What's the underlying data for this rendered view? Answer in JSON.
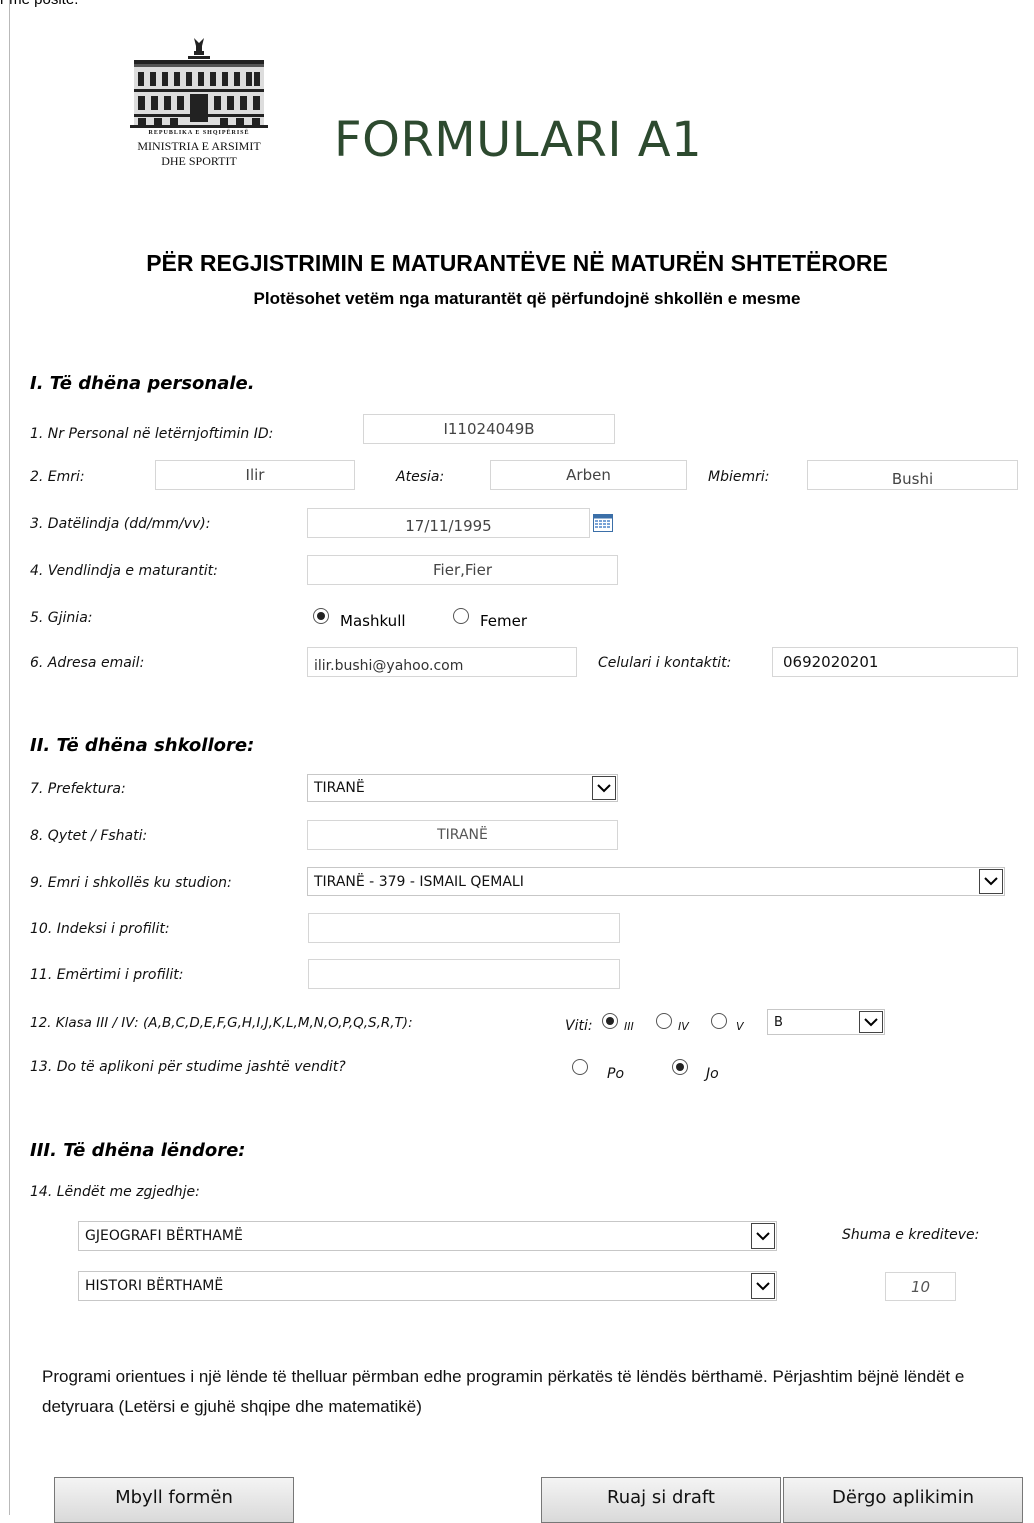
{
  "top_clip_text": "r me posite.",
  "logo": {
    "line1": "REPUBLIKA E SHQIPËRISË",
    "line2": "MINISTRIA E ARSIMIT",
    "line3": "DHE SPORTIT"
  },
  "title": "FORMULARI A1",
  "heading": "PËR REGJISTRIMIN E MATURANTËVE NË MATURËN SHTETËRORE",
  "subheading": "Plotësohet vetëm nga maturantët që përfundojnë shkollën e mesme",
  "section1": "I. Të dhëna personale.",
  "section2": "II. Të dhëna shkollore:",
  "section3": "III. Të dhëna lëndore:",
  "labels": {
    "nr_personal": "1. Nr Personal në letërnjoftimin ID:",
    "emri": "2. Emri:",
    "atesia": "Atesia:",
    "mbiemri": "Mbiemri:",
    "datelindja": "3. Datëlindja (dd/mm/vv):",
    "vendlindja": "4. Vendlindja e maturantit:",
    "gjinia": "5. Gjinia:",
    "email": "6. Adresa email:",
    "celulari": "Celulari i kontaktit:",
    "prefektura": "7. Prefektura:",
    "qytet": "8. Qytet / Fshati:",
    "shkolla": "9. Emri i shkollës ku studion:",
    "indeksi": "10. Indeksi i profilit:",
    "emertimi": "11. Emërtimi i profilit:",
    "klasa": "12. Klasa III / IV: (A,B,C,D,E,F,G,H,I,J,K,L,M,N,O,P,Q,S,R,T):",
    "jashte": "13. Do të aplikoni për studime jashtë vendit?",
    "lendet": "14. Lëndët me zgjedhje:",
    "shuma": "Shuma e krediteve:",
    "viti": "Viti:"
  },
  "values": {
    "nr_personal": "I11024049B",
    "emri": "Ilir",
    "atesia": "Arben",
    "mbiemri": "Bushi",
    "datelindja": "17/11/1995",
    "vendlindja": "Fier,Fier",
    "email": "ilir.bushi@yahoo.com",
    "celulari": "0692020201",
    "prefektura": "TIRANË",
    "qytet": "TIRANË",
    "shkolla": "TIRANË - 379 - ISMAIL QEMALI",
    "indeksi": "",
    "emertimi": "",
    "klasa": "B",
    "lenda1": "GJEOGRAFI BËRTHAMË",
    "lenda2": "HISTORI BËRTHAMË",
    "shuma": "10"
  },
  "options": {
    "gjinia": [
      "Mashkull",
      "Femer"
    ],
    "gjinia_selected": "Mashkull",
    "viti": [
      "III",
      "IV",
      "V"
    ],
    "viti_selected": "III",
    "jashte": [
      "Po",
      "Jo"
    ],
    "jashte_selected": "Jo"
  },
  "note": "Programi orientues i një lënde të thelluar përmban edhe programin përkatës të lëndës bërthamë. Përjashtim bëjnë lëndët e detyruara (Letërsi e gjuhë shqipe dhe matematikë)",
  "buttons": {
    "close": "Mbyll formën",
    "draft": "Ruaj si draft",
    "send": "Dërgo aplikimin"
  },
  "colors": {
    "title": "#2d4a2f"
  }
}
